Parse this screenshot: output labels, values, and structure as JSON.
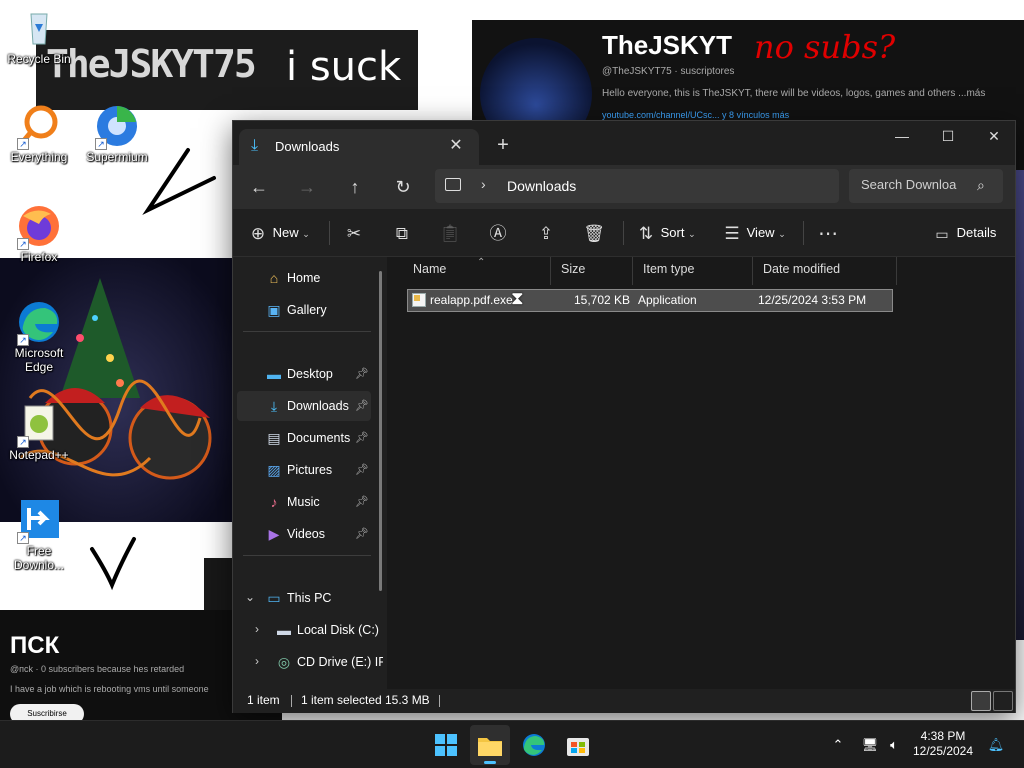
{
  "desktop": {
    "wallpaper": {
      "banner_text": "TheJSKYT75",
      "banner_suffix": "i suck",
      "channel_name": "TheJSKYT",
      "channel_handle": "@TheJSKYT75 · suscriptores",
      "channel_desc": "Hello everyone, this is TheJSKYT, there will be videos, logos, games and others ...más",
      "channel_link": "youtube.com/channel/UCsc... y 8 vínculos más",
      "scribble": "no subs?",
      "bottom_title": "ПСК",
      "bottom_sub": "@псk · 0 subscribers because hes retarded",
      "bottom_sub2": "I have a job which is rebooting vms until someone",
      "bottom_btn": "Suscribirse"
    },
    "icons": [
      {
        "label": "Recycle Bin"
      },
      {
        "label": "Everything"
      },
      {
        "label": "Supermium"
      },
      {
        "label": "Firefox"
      },
      {
        "label": "Microsoft Edge"
      },
      {
        "label": "Notepad++"
      },
      {
        "label": "Free Downlo..."
      }
    ]
  },
  "explorer": {
    "tab_title": "Downloads",
    "tab_close": "✕",
    "tab_new": "+",
    "window_buttons": {
      "minimize": "—",
      "maximize": "☐",
      "close": "✕"
    },
    "address": {
      "segment": "Downloads"
    },
    "search": {
      "placeholder": "Search Downloa"
    },
    "commands": {
      "new": "New",
      "sort": "Sort",
      "view": "View",
      "more": "⋯",
      "details": "Details"
    },
    "nav_pane": {
      "items": [
        {
          "label": "Home"
        },
        {
          "label": "Gallery"
        },
        {
          "label": "Desktop"
        },
        {
          "label": "Downloads"
        },
        {
          "label": "Documents"
        },
        {
          "label": "Pictures"
        },
        {
          "label": "Music"
        },
        {
          "label": "Videos"
        },
        {
          "label": "This PC"
        },
        {
          "label": "Local Disk (C:)"
        },
        {
          "label": "CD Drive (E:) IF"
        }
      ]
    },
    "columns": {
      "name": "Name",
      "size": "Size",
      "type": "Item type",
      "date": "Date modified"
    },
    "files": [
      {
        "name": "realapp.pdf.exe",
        "size": "15,702 KB",
        "type": "Application",
        "date": "12/25/2024 3:53 PM",
        "selected": true
      }
    ],
    "status": {
      "count": "1 item",
      "selected": "1 item selected",
      "size": "15.3 MB"
    }
  },
  "taskbar": {
    "clock_time": "4:38 PM",
    "clock_date": "12/25/2024"
  },
  "colors": {
    "accent": "#4cc2ff",
    "window_bg": "#202020",
    "selection": "#4d4d4d"
  }
}
